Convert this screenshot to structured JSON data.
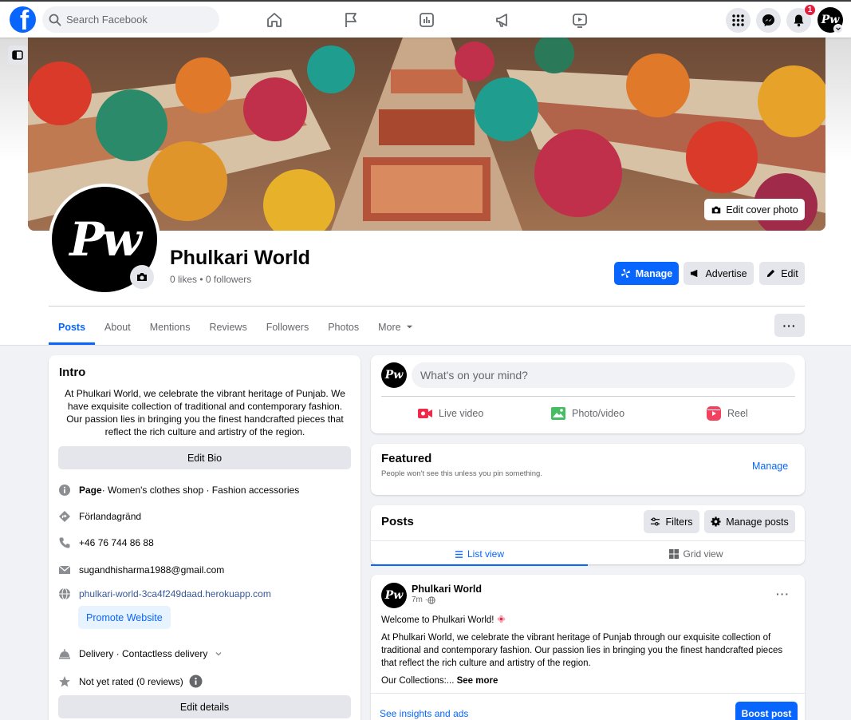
{
  "nav": {
    "search_placeholder": "Search Facebook",
    "notification_count": "1",
    "avatar_text": "Pw"
  },
  "cover": {
    "edit_label": "Edit cover photo"
  },
  "page": {
    "name": "Phulkari World",
    "stats": "0 likes • 0 followers",
    "avatar_text": "Pw",
    "buttons": {
      "manage": "Manage",
      "advertise": "Advertise",
      "edit": "Edit"
    }
  },
  "tabs": [
    {
      "label": "Posts",
      "active": true
    },
    {
      "label": "About"
    },
    {
      "label": "Mentions"
    },
    {
      "label": "Reviews"
    },
    {
      "label": "Followers"
    },
    {
      "label": "Photos"
    },
    {
      "label": "More"
    }
  ],
  "intro": {
    "title": "Intro",
    "bio": "At Phulkari World, we celebrate the vibrant heritage of Punjab. We have exquisite collection of traditional and contemporary fashion. Our passion lies in bringing you the finest handcrafted pieces that reflect the rich culture and artistry of the region.",
    "edit_bio": "Edit Bio",
    "page_label": "Page",
    "categories": " · Women's clothes shop · Fashion accessories",
    "address": "Förlandagränd",
    "phone": "+46 76 744 86 88",
    "email": "sugandhisharma1988@gmail.com",
    "website": "phulkari-world-3ca4f249daad.herokuapp.com",
    "promote_website": "Promote Website",
    "delivery": "Delivery · Contactless delivery",
    "rating": "Not yet rated (0 reviews)",
    "edit_details": "Edit details"
  },
  "composer": {
    "placeholder": "What's on your mind?",
    "actions": {
      "live": "Live video",
      "photo": "Photo/video",
      "reel": "Reel"
    }
  },
  "featured": {
    "title": "Featured",
    "subtitle": "People won't see this unless you pin something.",
    "manage": "Manage"
  },
  "posts_section": {
    "title": "Posts",
    "filters": "Filters",
    "manage_posts": "Manage posts",
    "list_view": "List view",
    "grid_view": "Grid view"
  },
  "post": {
    "author": "Phulkari World",
    "time": "7m · ",
    "line1": "Welcome to Phulkari World! ",
    "body": "At Phulkari World, we celebrate the vibrant heritage of Punjab through our exquisite collection of traditional and contemporary fashion. Our passion lies in bringing you the finest handcrafted pieces that reflect the rich culture and artistry of the region.",
    "collections": "Our Collections:... ",
    "see_more": "See more",
    "insights": "See insights and ads",
    "boost": "Boost post"
  },
  "colors": {
    "brand": "#0866ff",
    "background": "#f0f2f5",
    "button_grey": "#e4e6eb"
  },
  "icons": [
    "facebook-logo-icon",
    "search-icon",
    "home-icon",
    "flag-icon",
    "chart-icon",
    "megaphone-icon",
    "video-icon",
    "grid-menu-icon",
    "messenger-icon",
    "bell-icon",
    "camera-icon",
    "info-icon",
    "location-icon",
    "phone-icon",
    "email-icon",
    "globe-icon",
    "delivery-bell-icon",
    "star-icon",
    "live-video-icon",
    "photo-icon",
    "reel-icon",
    "filters-icon",
    "gear-icon",
    "list-icon",
    "grid-icon"
  ]
}
